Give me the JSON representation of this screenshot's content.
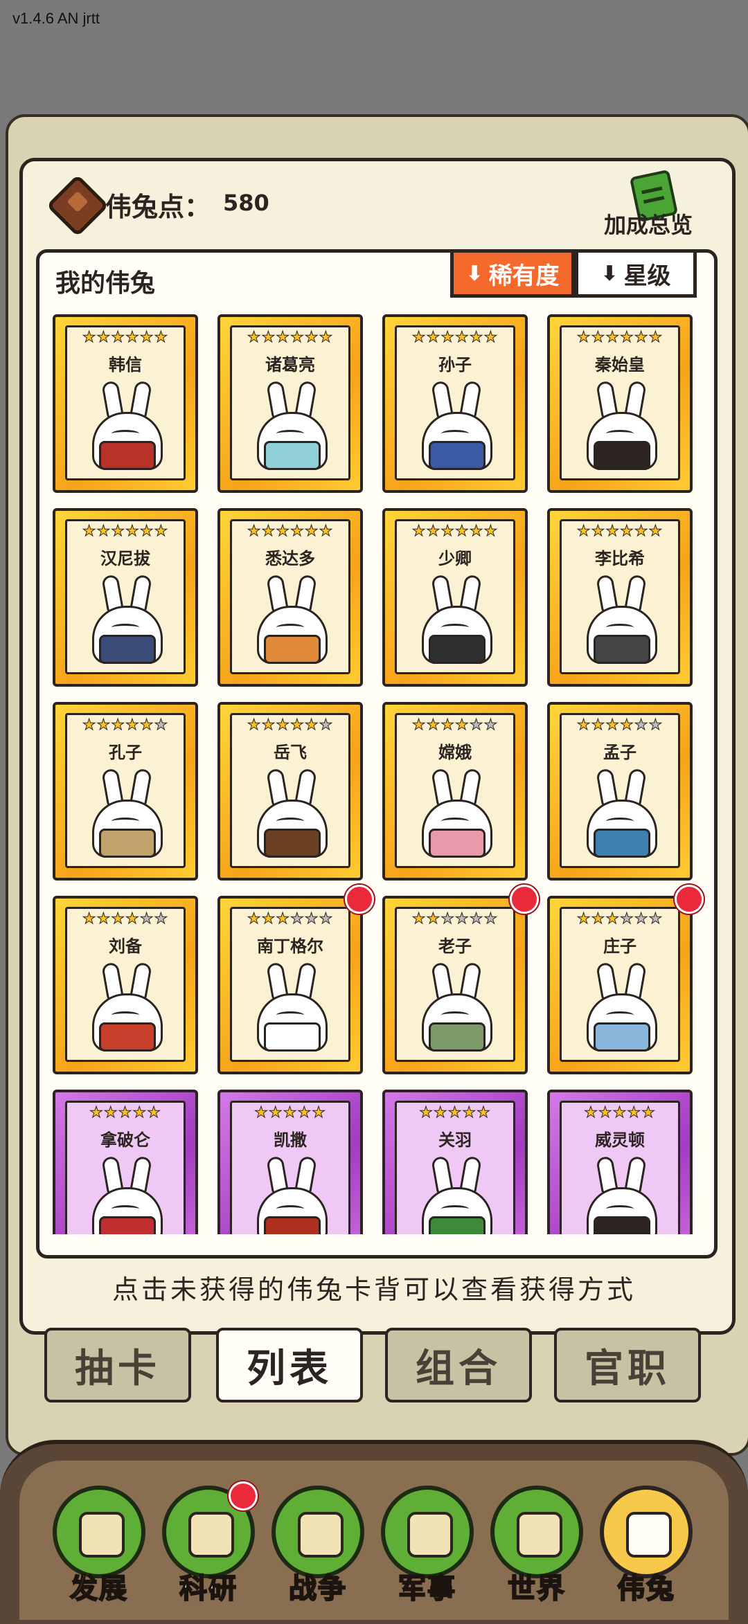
{
  "version": "v1.4.6 AN jrtt",
  "header": {
    "points_label": "伟兔点：",
    "points_value": "580",
    "bonus_label": "加成总览"
  },
  "collection": {
    "title": "我的伟兔",
    "sort_rarity": "稀有度",
    "sort_star": "星级"
  },
  "cards": [
    {
      "name": "韩信",
      "stars": 6,
      "rarity": "gold",
      "outfit": "#b8322a",
      "badge": false
    },
    {
      "name": "诸葛亮",
      "stars": 6,
      "rarity": "gold",
      "outfit": "#8fd0d8",
      "badge": false
    },
    {
      "name": "孙子",
      "stars": 6,
      "rarity": "gold",
      "outfit": "#3a5aa6",
      "badge": false
    },
    {
      "name": "秦始皇",
      "stars": 6,
      "rarity": "gold",
      "outfit": "#2b2420",
      "badge": false
    },
    {
      "name": "汉尼拔",
      "stars": 6,
      "rarity": "gold",
      "outfit": "#3c4c78",
      "badge": false
    },
    {
      "name": "悉达多",
      "stars": 6,
      "rarity": "gold",
      "outfit": "#e08a3a",
      "badge": false
    },
    {
      "name": "少卿",
      "stars": 6,
      "rarity": "gold",
      "outfit": "#2f2f2f",
      "badge": false
    },
    {
      "name": "李比希",
      "stars": 6,
      "rarity": "gold",
      "outfit": "#454545",
      "badge": false
    },
    {
      "name": "孔子",
      "stars": 5,
      "rarity": "gold",
      "outfit": "#c0a36a",
      "badge": false
    },
    {
      "name": "岳飞",
      "stars": 5,
      "rarity": "gold",
      "outfit": "#6b4023",
      "badge": false
    },
    {
      "name": "嫦娥",
      "stars": 4,
      "rarity": "gold",
      "outfit": "#e99aa8",
      "badge": false
    },
    {
      "name": "孟子",
      "stars": 4,
      "rarity": "gold",
      "outfit": "#3c7fb0",
      "badge": false
    },
    {
      "name": "刘备",
      "stars": 4,
      "rarity": "gold",
      "outfit": "#c8402b",
      "badge": false
    },
    {
      "name": "南丁格尔",
      "stars": 3,
      "rarity": "gold",
      "outfit": "#ffffff",
      "badge": true
    },
    {
      "name": "老子",
      "stars": 2,
      "rarity": "gold",
      "outfit": "#7f9a6a",
      "badge": true
    },
    {
      "name": "庄子",
      "stars": 3,
      "rarity": "gold",
      "outfit": "#8ab6dc",
      "badge": true
    },
    {
      "name": "拿破仑",
      "stars": 5,
      "rarity": "purple",
      "outfit": "#c03030",
      "badge": false
    },
    {
      "name": "凯撒",
      "stars": 5,
      "rarity": "purple",
      "outfit": "#b03020",
      "badge": false
    },
    {
      "name": "关羽",
      "stars": 5,
      "rarity": "purple",
      "outfit": "#3d8a3a",
      "badge": false
    },
    {
      "name": "威灵顿",
      "stars": 5,
      "rarity": "purple",
      "outfit": "#2b2420",
      "badge": false
    }
  ],
  "hint": "点击未获得的伟兔卡背可以查看获得方式",
  "tabs": [
    "抽卡",
    "列表",
    "组合",
    "官职"
  ],
  "active_tab": 1,
  "nav": [
    {
      "label": "发展",
      "icon": "arrow-up-icon",
      "badge": false
    },
    {
      "label": "科研",
      "icon": "flask-icon",
      "badge": true
    },
    {
      "label": "战争",
      "icon": "swords-icon",
      "badge": false
    },
    {
      "label": "军事",
      "icon": "helmet-icon",
      "badge": false
    },
    {
      "label": "世界",
      "icon": "globe-icon",
      "badge": false
    },
    {
      "label": "伟兔",
      "icon": "rabbit-card-icon",
      "badge": false
    }
  ],
  "active_nav": 5
}
